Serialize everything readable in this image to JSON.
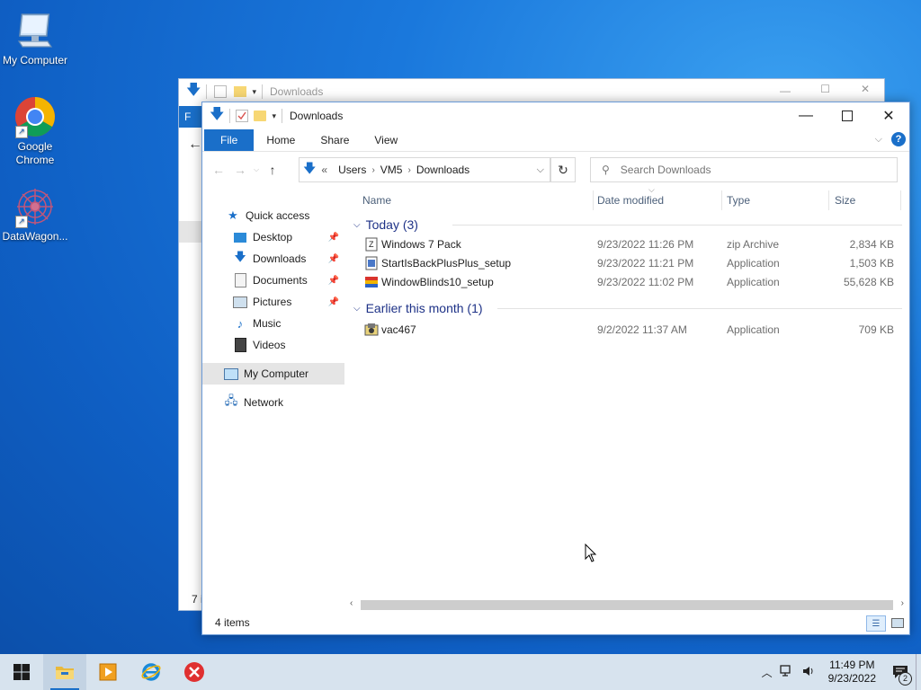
{
  "desktop": {
    "icons": [
      {
        "label": "My Computer"
      },
      {
        "label": "Google Chrome"
      },
      {
        "label": "DataWagon..."
      }
    ]
  },
  "back_window": {
    "title": "Downloads",
    "ribbon_file": "F",
    "status_partial": "7 i"
  },
  "window": {
    "title": "Downloads",
    "ribbon_tabs": [
      "File",
      "Home",
      "Share",
      "View"
    ],
    "breadcrumb": {
      "overflow": "«",
      "items": [
        "Users",
        "VM5",
        "Downloads"
      ]
    },
    "search_placeholder": "Search Downloads",
    "nav_pane": [
      {
        "label": "Quick access",
        "icon": "star-icon",
        "pinned": false
      },
      {
        "label": "Desktop",
        "icon": "desktop-folder-icon",
        "pinned": true
      },
      {
        "label": "Downloads",
        "icon": "download-arrow-icon",
        "pinned": true
      },
      {
        "label": "Documents",
        "icon": "documents-icon",
        "pinned": true
      },
      {
        "label": "Pictures",
        "icon": "pictures-icon",
        "pinned": true
      },
      {
        "label": "Music",
        "icon": "music-note-icon",
        "pinned": false
      },
      {
        "label": "Videos",
        "icon": "video-icon",
        "pinned": false
      },
      {
        "label": "My Computer",
        "icon": "computer-icon",
        "pinned": false,
        "selected": true
      },
      {
        "label": "Network",
        "icon": "network-icon",
        "pinned": false
      }
    ],
    "columns": [
      "Name",
      "Date modified",
      "Type",
      "Size"
    ],
    "groups": [
      {
        "label": "Today (3)",
        "files": [
          {
            "name": "Windows 7 Pack",
            "date": "9/23/2022 11:26 PM",
            "type": "zip Archive",
            "size": "2,834 KB",
            "icon": "zip-archive-icon"
          },
          {
            "name": "StartIsBackPlusPlus_setup",
            "date": "9/23/2022 11:21 PM",
            "type": "Application",
            "size": "1,503 KB",
            "icon": "installer-icon"
          },
          {
            "name": "WindowBlinds10_setup",
            "date": "9/23/2022 11:02 PM",
            "type": "Application",
            "size": "55,628 KB",
            "icon": "windowblinds-icon"
          }
        ]
      },
      {
        "label": "Earlier this month (1)",
        "files": [
          {
            "name": "vac467",
            "date": "9/2/2022 11:37 AM",
            "type": "Application",
            "size": "709 KB",
            "icon": "setup-exe-icon"
          }
        ]
      }
    ],
    "status": "4 items"
  },
  "taskbar": {
    "clock_time": "11:49 PM",
    "clock_date": "9/23/2022",
    "notification_count": "2"
  }
}
